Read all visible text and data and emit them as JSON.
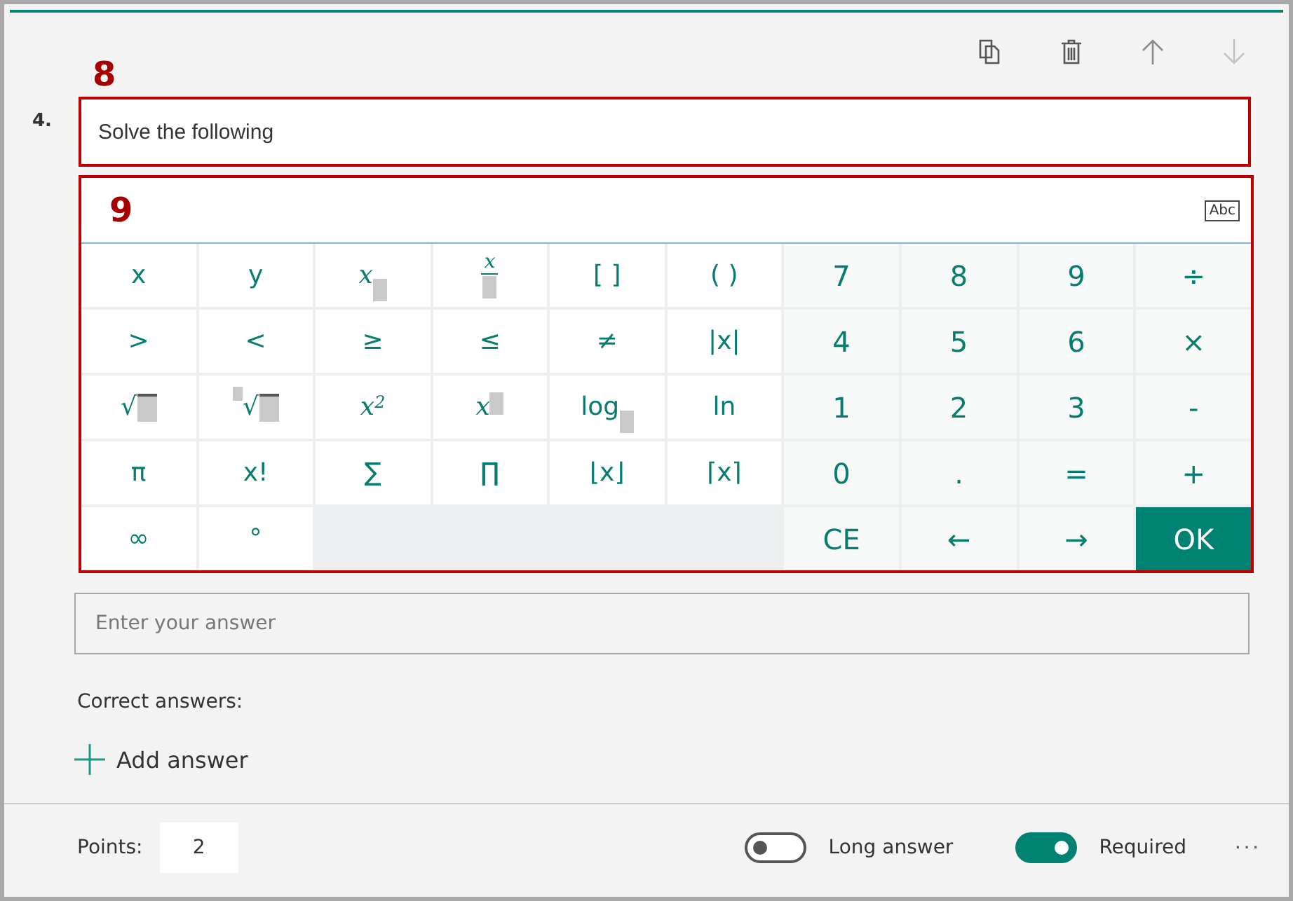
{
  "toolbar": [
    {
      "disabled": false
    },
    {
      "disabled": false
    },
    {
      "disabled": false
    },
    {
      "disabled": true
    }
  ],
  "question": {
    "annotation": "8",
    "number": "4.",
    "text": "Solve the following"
  },
  "math_input": {
    "annotation": "9",
    "mode_button": "Abc",
    "symbol_keys": [
      {
        "kind": "text",
        "label": "x"
      },
      {
        "kind": "text",
        "label": "y"
      },
      {
        "kind": "sub",
        "label": "x"
      },
      {
        "kind": "frac",
        "label": "x"
      },
      {
        "kind": "text",
        "label": "[ ]"
      },
      {
        "kind": "text",
        "label": "( )"
      },
      {
        "kind": "text",
        "label": ">"
      },
      {
        "kind": "text",
        "label": "<"
      },
      {
        "kind": "text",
        "label": "≥"
      },
      {
        "kind": "text",
        "label": "≤"
      },
      {
        "kind": "text",
        "label": "≠"
      },
      {
        "kind": "text",
        "label": "|x|"
      },
      {
        "kind": "sqrt",
        "label": "√"
      },
      {
        "kind": "root",
        "label": "√"
      },
      {
        "kind": "sup",
        "label": "x",
        "sup": "2"
      },
      {
        "kind": "sup",
        "label": "x"
      },
      {
        "kind": "sub",
        "label": "log"
      },
      {
        "kind": "text",
        "label": "ln"
      },
      {
        "kind": "text",
        "label": "π"
      },
      {
        "kind": "text",
        "label": "x!"
      },
      {
        "kind": "text",
        "label": "∑"
      },
      {
        "kind": "text",
        "label": "∏"
      },
      {
        "kind": "text",
        "label": "⌊x⌋"
      },
      {
        "kind": "text",
        "label": "⌈x⌉"
      },
      {
        "kind": "text",
        "label": "∞"
      },
      {
        "kind": "text",
        "label": "°"
      }
    ],
    "number_keys": [
      {
        "kind": "text",
        "label": "7"
      },
      {
        "kind": "text",
        "label": "8"
      },
      {
        "kind": "text",
        "label": "9"
      },
      {
        "kind": "text",
        "label": "÷"
      },
      {
        "kind": "text",
        "label": "4"
      },
      {
        "kind": "text",
        "label": "5"
      },
      {
        "kind": "text",
        "label": "6"
      },
      {
        "kind": "text",
        "label": "×"
      },
      {
        "kind": "text",
        "label": "1"
      },
      {
        "kind": "text",
        "label": "2"
      },
      {
        "kind": "text",
        "label": "3"
      },
      {
        "kind": "text",
        "label": "-"
      },
      {
        "kind": "text",
        "label": "0"
      },
      {
        "kind": "text",
        "label": "."
      },
      {
        "kind": "text",
        "label": "="
      },
      {
        "kind": "text",
        "label": "+"
      },
      {
        "kind": "text",
        "label": "CE"
      },
      {
        "kind": "text",
        "label": "←"
      },
      {
        "kind": "text",
        "label": "→"
      },
      {
        "kind": "primary",
        "label": "OK"
      }
    ]
  },
  "answer_field": {
    "placeholder": "Enter your answer"
  },
  "correct_answers_label": "Correct answers:",
  "add_answer": "Add answer",
  "footer": {
    "points_label": "Points:",
    "points_value": "2",
    "toggles": [
      {
        "label": "Long answer",
        "on": false
      },
      {
        "label": "Required",
        "on": true
      }
    ],
    "more": "···"
  }
}
